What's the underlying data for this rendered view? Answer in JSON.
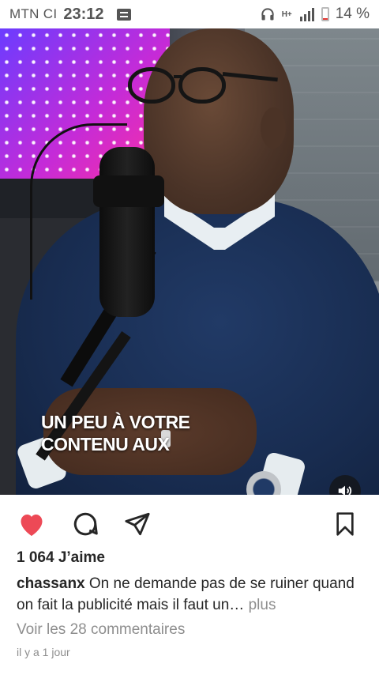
{
  "status_bar": {
    "carrier": "MTN CI",
    "time": "23:12",
    "network_label": "H+",
    "battery": "14 %",
    "battery_level": 0.14,
    "battery_color": "#e53935",
    "icons": [
      "notification-icon",
      "headphones-icon",
      "signal-icon",
      "battery-icon"
    ]
  },
  "video": {
    "caption_line1": "UN PEU À VOTRE",
    "caption_line2": "CONTENU AUX",
    "volume_icon": "volume-icon"
  },
  "actions": {
    "like_icon": "heart-icon",
    "like_color": "#ed4956",
    "comment_icon": "comment-icon",
    "share_icon": "send-icon",
    "save_icon": "bookmark-icon"
  },
  "post": {
    "likes": "1 064 J’aime",
    "username": "chassanx",
    "caption": "On ne demande pas de se ruiner quand on fait la publicité mais il faut un…",
    "more": "plus",
    "comments": "Voir les 28 commentaires",
    "time_ago": "il y a 1 jour"
  }
}
